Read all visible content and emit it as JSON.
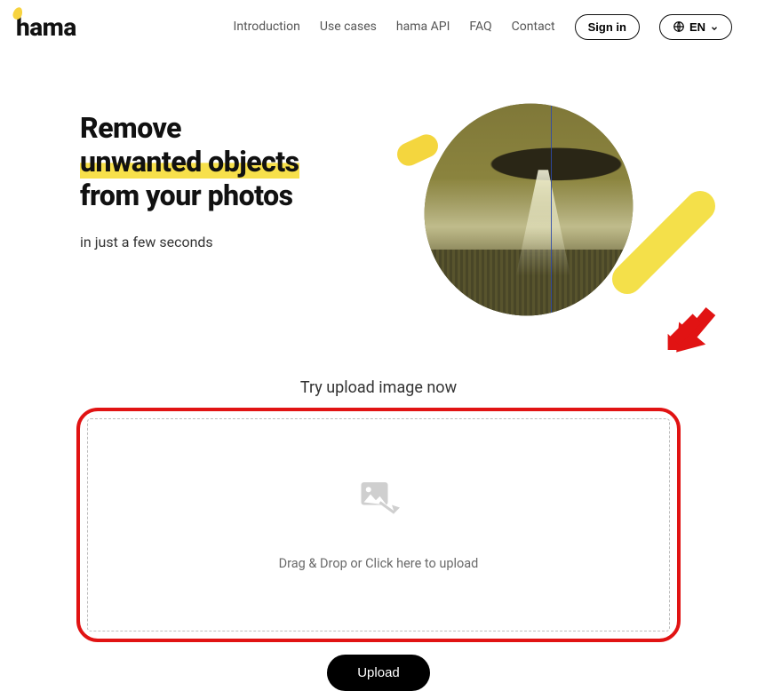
{
  "brand": {
    "name": "hama"
  },
  "nav": {
    "items": [
      {
        "label": "Introduction"
      },
      {
        "label": "Use cases"
      },
      {
        "label": "hama API"
      },
      {
        "label": "FAQ"
      },
      {
        "label": "Contact"
      }
    ],
    "signin": "Sign in",
    "lang": "EN"
  },
  "hero": {
    "line1": "Remove",
    "line2": "unwanted objects",
    "line3": "from your photos",
    "sub": "in just a few seconds"
  },
  "upload": {
    "try_label": "Try upload image now",
    "drop_text": "Drag & Drop or Click here to upload",
    "button": "Upload"
  }
}
